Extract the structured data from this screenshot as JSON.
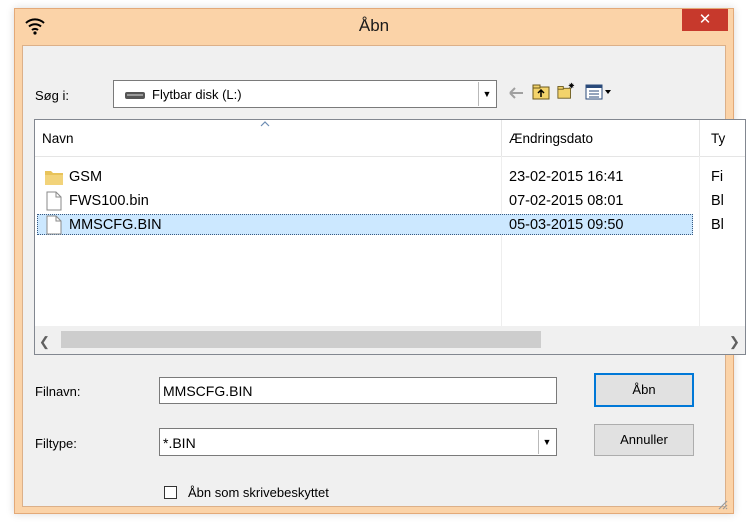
{
  "window": {
    "title": "Åbn",
    "close_glyph": "✕"
  },
  "lookin": {
    "label": "Søg i:",
    "value": "Flytbar disk (L:)"
  },
  "columns": {
    "name": "Navn",
    "date": "Ændringsdato",
    "type": "Ty"
  },
  "files": [
    {
      "name": "GSM",
      "date": "23-02-2015 16:41",
      "type": "Fi",
      "icon": "folder-icon"
    },
    {
      "name": "FWS100.bin",
      "date": "07-02-2015 08:01",
      "type": "Bl",
      "icon": "file-icon"
    },
    {
      "name": "MMSCFG.BIN",
      "date": "05-03-2015 09:50",
      "type": "Bl",
      "icon": "file-icon",
      "selected": true
    }
  ],
  "filename": {
    "label": "Filnavn:",
    "value": "MMSCFG.BIN"
  },
  "filetype": {
    "label": "Filtype:",
    "value": "*.BIN"
  },
  "buttons": {
    "open": "Åbn",
    "cancel": "Annuller"
  },
  "readonly": {
    "label": "Åbn som skrivebeskyttet",
    "checked": false
  },
  "colors": {
    "frame": "#fbd3a8",
    "close": "#c7392c",
    "selection": "#cce8ff",
    "default_button_border": "#0078d7"
  }
}
